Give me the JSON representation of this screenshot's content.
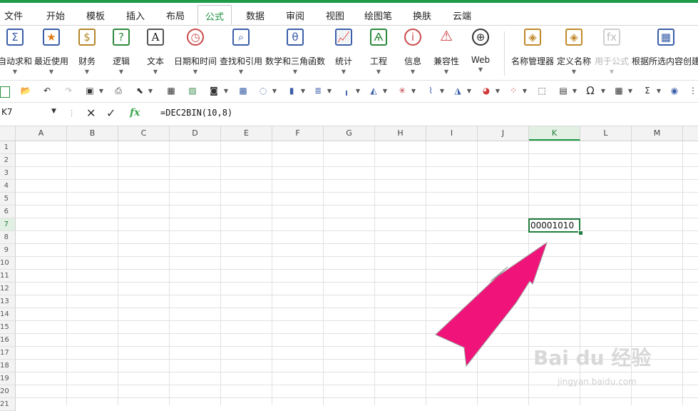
{
  "tabs": [
    "文件",
    "开始",
    "模板",
    "插入",
    "布局",
    "公式",
    "数据",
    "审阅",
    "视图",
    "绘图笔",
    "换肤",
    "云端"
  ],
  "active_tab": "公式",
  "ribbon": {
    "autosum": "自动求和",
    "recent": "最近使用",
    "finance": "财务",
    "logic": "逻辑",
    "text": "文本",
    "datetime": "日期和时间",
    "lookup": "查找和引用",
    "math": "数学和三角函数",
    "stats": "统计",
    "engineering": "工程",
    "info": "信息",
    "compat": "兼容性",
    "web": "Web",
    "name_manager": "名称管理器",
    "define_name": "定义名称",
    "use_in_formula": "用于公式",
    "create_from_sel": "根据所选内容创建"
  },
  "formula_bar": {
    "name_box": "K7",
    "formula": "=DEC2BIN(10,8)",
    "fx": "fx"
  },
  "columns": [
    "A",
    "B",
    "C",
    "D",
    "E",
    "F",
    "G",
    "H",
    "I",
    "J",
    "K",
    "L",
    "M"
  ],
  "selected_column": "K",
  "rows": [
    "1",
    "2",
    "3",
    "4",
    "5",
    "6",
    "7",
    "8",
    "9",
    "10",
    "11",
    "12",
    "13",
    "14",
    "15",
    "16",
    "17",
    "18",
    "19",
    "20",
    "21"
  ],
  "selected_row": "7",
  "cell_k7": "00001010",
  "watermark": {
    "brand": "Bai du 经验",
    "url": "jingyan.baidu.com"
  },
  "colors": {
    "accent": "#1e9c47",
    "arrow": "#f0147a"
  }
}
